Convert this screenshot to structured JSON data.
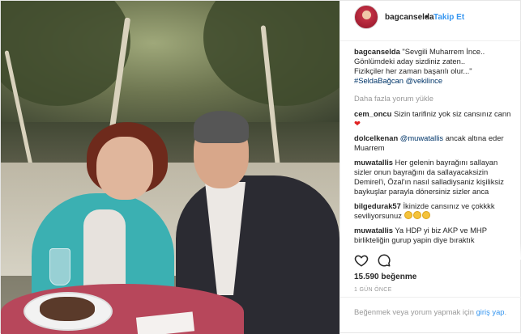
{
  "post": {
    "username": "bagcanselda",
    "separator": "•",
    "follow_label": "Takip Et",
    "caption": {
      "username": "bagcanselda",
      "line1": "\"Sevgili Muharrem İnce..",
      "line2": "Gönlümdeki aday sizdiniz zaten..",
      "line3": "Fizikçiler her zaman başarılı olur...\"",
      "hashtag": "#SeldaBağcan",
      "mention": "@vekilince"
    },
    "load_more": "Daha fazla yorum yükle",
    "comments": [
      {
        "user": "cem_oncu",
        "text": "Sizin tarifiniz yok siz cansınız cann",
        "suffix": "❤"
      },
      {
        "user": "dolcelkenan",
        "mention": "@muwatallis",
        "text": "ancak altına eder Muarrem"
      },
      {
        "user": "muwatallis",
        "text": "Her gelenin bayrağını sallayan sizler onun bayrağını da sallayacaksizin Demirel'i, Özal'ın nasıl salladiysaniz kişiliksiz baykuşlar parayla dönersiniz sizler anca"
      },
      {
        "user": "bilgedurak57",
        "text": "İkinizde cansınız ve çokkkk seviliyorsunuz"
      },
      {
        "user": "muwatallis",
        "text": "Ya HDP yi biz AKP ve MHP birlikteliğin gurup yapin diye bıraktık"
      }
    ],
    "likes": "15.590 beğenme",
    "time": "1 GÜN ÖNCE",
    "footer": {
      "text": "Beğenmek veya yorum yapmak için",
      "link": "giriş yap",
      "end": "."
    }
  },
  "colors": {
    "link_blue": "#3897f0",
    "hashtag_blue": "#003569",
    "muted": "#999999",
    "heart_red": "#e02020"
  },
  "icons": [
    "heart-icon",
    "comment-icon"
  ]
}
